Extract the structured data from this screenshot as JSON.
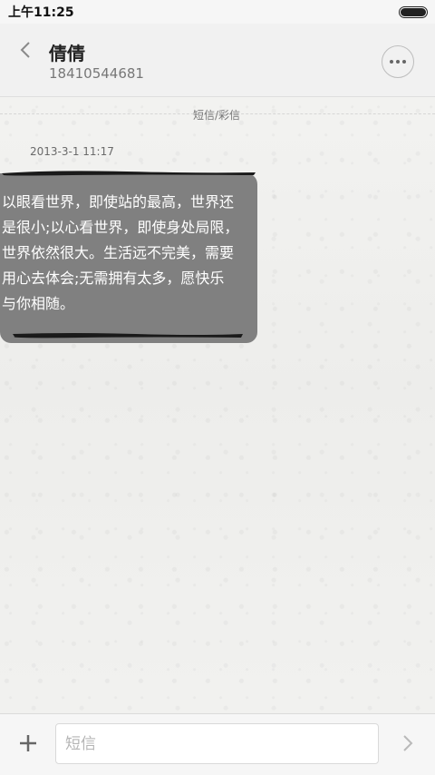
{
  "status_bar": {
    "time": "上午11:25"
  },
  "header": {
    "contact_name": "倩倩",
    "phone_number": "18410544681",
    "back_icon": "chevron-left-icon",
    "more_icon": "more-dots-icon"
  },
  "thread": {
    "channel_label": "短信/彩信",
    "messages": [
      {
        "timestamp": "2013-3-1 11:17",
        "text": "以眼看世界，即使站的最高，世界还\n是很小;以心看世界，即使身处局限，\n世界依然很大。生活远不完美，需要\n用心去体会;无需拥有太多，愿快乐\n与你相随。"
      }
    ]
  },
  "composer": {
    "placeholder": "短信",
    "value": "",
    "add_icon": "plus-icon",
    "send_icon": "send-chevron-icon"
  },
  "colors": {
    "bubble": "#808080",
    "background": "#f3f3f1",
    "header": "#f1f1f1"
  }
}
